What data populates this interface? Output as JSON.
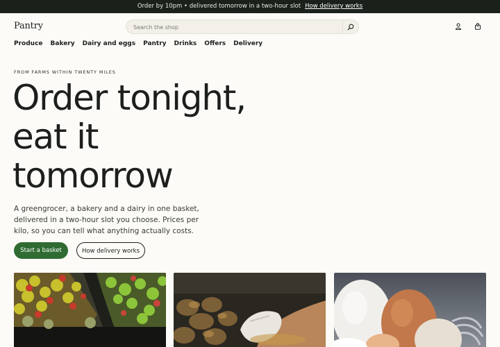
{
  "announcement": {
    "text": "Order by 10pm • delivered tomorrow in a two-hour slot",
    "link": "How delivery works"
  },
  "header": {
    "logo": "Pantry",
    "search_placeholder": "Search the shop",
    "icons": [
      "search-icon",
      "account-icon",
      "basket-icon"
    ]
  },
  "nav": {
    "items": [
      "Produce",
      "Bakery",
      "Dairy and eggs",
      "Pantry",
      "Drinks",
      "Offers",
      "Delivery"
    ]
  },
  "hero": {
    "eyebrow": "FROM FARMS WITHIN TWENTY MILES",
    "headline_line1": "Order tonight,",
    "headline_line2": "eat it",
    "headline_line3": "tomorrow",
    "lead": "A greengrocer, a bakery and a dairy in one basket, delivered in a two-hour slot you choose. Prices per kilo, so you can tell what anything actually costs.",
    "primary_cta": "Start a basket",
    "secondary_cta": "How delivery works"
  },
  "colors": {
    "announce_bg": "#1a211b",
    "accent_green": "#2f6b32",
    "page_bg": "#fcfbf7"
  }
}
